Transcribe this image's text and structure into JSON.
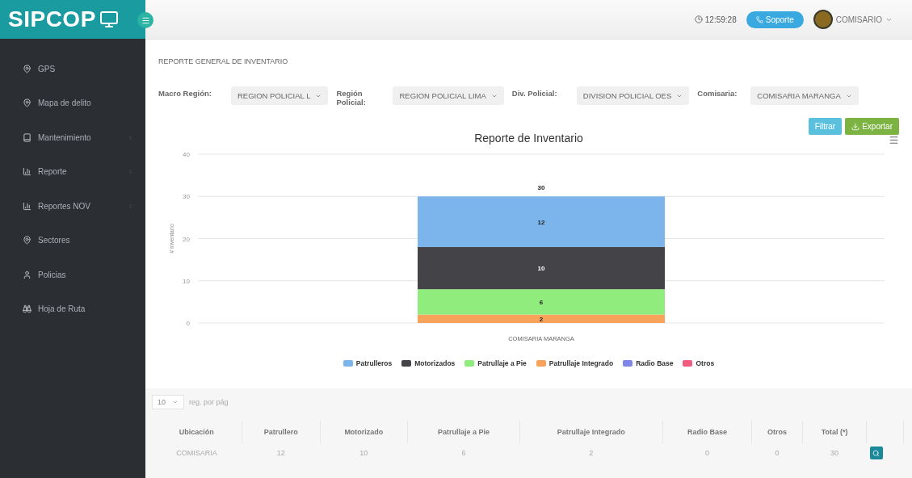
{
  "logo": {
    "text": "SIPCOP"
  },
  "topbar": {
    "time": "12:59:28",
    "support_button": "Soporte",
    "user": "COMISARIO"
  },
  "sidebar": {
    "items": [
      {
        "label": "GPS",
        "kind": "pin",
        "has_submenu": false
      },
      {
        "label": "Mapa de delito",
        "kind": "pin",
        "has_submenu": false
      },
      {
        "label": "Mantenimiento",
        "kind": "book",
        "has_submenu": true
      },
      {
        "label": "Reporte",
        "kind": "chart",
        "has_submenu": true
      },
      {
        "label": "Reportes NOV",
        "kind": "chart",
        "has_submenu": true
      },
      {
        "label": "Sectores",
        "kind": "pin",
        "has_submenu": false
      },
      {
        "label": "Policias",
        "kind": "user",
        "has_submenu": false
      },
      {
        "label": "Hoja de Ruta",
        "kind": "binoculars",
        "has_submenu": false
      }
    ]
  },
  "breadcrumb": "REPORTE GENERAL DE INVENTARIO",
  "filters": [
    {
      "label": "Macro Región:",
      "value": "REGION POLICIAL L"
    },
    {
      "label": "Región Policial:",
      "value": "REGION POLICIAL LIMA"
    },
    {
      "label": "Div. Policial:",
      "value": "DIVISION POLICIAL OES"
    },
    {
      "label": "Comisaria:",
      "value": "COMISARIA MARANGA"
    }
  ],
  "actions": [
    {
      "label": "Filtrar",
      "kind": "filter"
    },
    {
      "label": "Exportar",
      "kind": "export"
    }
  ],
  "chart": {
    "chart_data": {
      "type": "bar",
      "title": "Reporte de Inventario",
      "ylabel": "# Inventario",
      "categories": [
        "COMISARIA MARANGA"
      ],
      "stacked": true,
      "ylim": [
        0,
        40
      ],
      "yticks": [
        0,
        10,
        20,
        30,
        40
      ],
      "series": [
        {
          "name": "Patrulleros",
          "color": "#7cb5ec",
          "values": [
            12
          ]
        },
        {
          "name": "Motorizados",
          "color": "#434348",
          "values": [
            10
          ]
        },
        {
          "name": "Patrullaje a Pie",
          "color": "#90ed7d",
          "values": [
            6
          ]
        },
        {
          "name": "Patrullaje Integrado",
          "color": "#f7a35c",
          "values": [
            2
          ]
        },
        {
          "name": "Radio Base",
          "color": "#8085e9",
          "values": [
            0
          ]
        },
        {
          "name": "Otros",
          "color": "#f15c80",
          "values": [
            0
          ]
        }
      ],
      "value_labels": [
        [
          "12"
        ],
        [
          "10"
        ],
        [
          "6"
        ],
        [
          "2"
        ],
        [
          null
        ],
        [
          null
        ]
      ],
      "grid": true,
      "legend": "bottom",
      "annotations": [
        "30"
      ]
    }
  },
  "page_size": {
    "value": "10",
    "label": "reg. por pág"
  },
  "table": {
    "columns": [
      "Ubicación",
      "Patrullero",
      "Motorizado",
      "Patrullaje a Pie",
      "Patrullaje Integrado",
      "Radio Base",
      "Otros",
      "Total (*)"
    ],
    "rows": [
      [
        "COMISARIA",
        "12",
        "10",
        "6",
        "2",
        "0",
        "0",
        "30"
      ]
    ]
  }
}
